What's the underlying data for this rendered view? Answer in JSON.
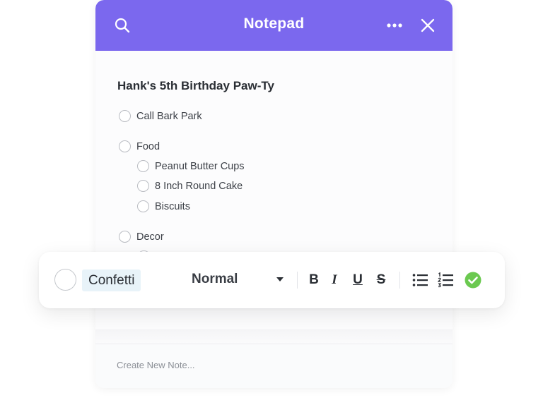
{
  "header": {
    "title": "Notepad",
    "color": "#7b68ee",
    "icons": {
      "search": "search-icon",
      "more": "more-icon",
      "close": "close-icon"
    }
  },
  "note": {
    "title": "Hank's 5th Birthday Paw-Ty",
    "items": [
      {
        "label": "Call Bark Park",
        "level": 0
      },
      {
        "label": "Food",
        "level": 0
      },
      {
        "label": "Peanut Butter Cups",
        "level": 1
      },
      {
        "label": "8 Inch Round Cake",
        "level": 1
      },
      {
        "label": "Biscuits",
        "level": 1
      },
      {
        "label": "Decor",
        "level": 0
      }
    ]
  },
  "toolbar": {
    "editing_text": "Confetti",
    "text_style": "Normal",
    "format_buttons": {
      "bold": "B",
      "italic": "I",
      "underline": "U",
      "strikethrough": "S"
    },
    "list_icons": [
      "bullet-list-icon",
      "numbered-list-icon"
    ],
    "confirm_icon": "checkmark-icon",
    "confirm_color": "#6bc950"
  },
  "footer": {
    "create_placeholder": "Create New Note..."
  }
}
